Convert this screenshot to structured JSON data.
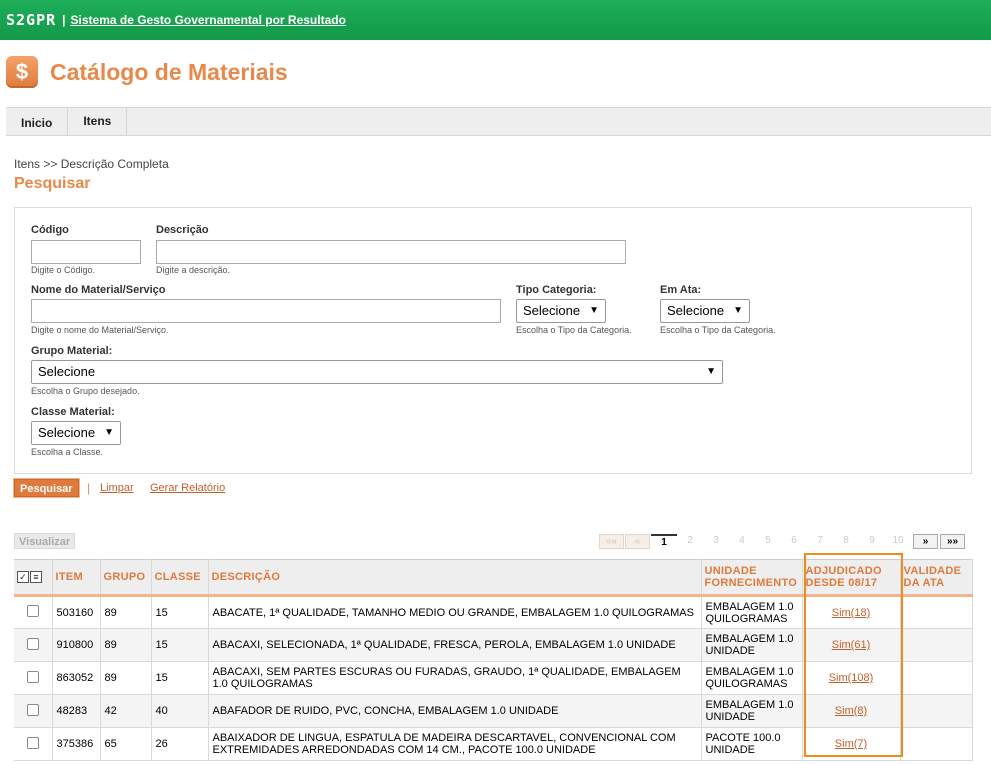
{
  "header": {
    "logo": "S2GPR",
    "separator": "|",
    "system_name": "Sistema de Gesto Governamental por Resultado"
  },
  "page": {
    "icon": "dollar-icon",
    "title": "Catálogo de Materiais"
  },
  "nav": {
    "tabs": [
      "Inicio",
      "Itens"
    ]
  },
  "breadcrumb": "Itens >> Descrição Completa",
  "section_title": "Pesquisar",
  "form": {
    "codigo": {
      "label": "Código",
      "hint": "Digite o Código.",
      "value": ""
    },
    "descricao": {
      "label": "Descrição",
      "hint": "Digite a descrição.",
      "value": ""
    },
    "nome": {
      "label": "Nome do Material/Serviço",
      "hint": "Digite o nome do Material/Serviço.",
      "value": ""
    },
    "tipo_categoria": {
      "label": "Tipo Categoria:",
      "hint": "Escolha o Tipo da Categoria.",
      "value": "Selecione"
    },
    "em_ata": {
      "label": "Em Ata:",
      "hint": "Escolha o Tipo da Categoria.",
      "value": "Selecione"
    },
    "grupo": {
      "label": "Grupo Material:",
      "hint": "Escolha o Grupo desejado.",
      "value": "Selecione"
    },
    "classe": {
      "label": "Classe Material:",
      "hint": "Escolha a Classe.",
      "value": "Selecione"
    }
  },
  "actions": {
    "search": "Pesquisar",
    "separator": "|",
    "clear": "Limpar",
    "report": "Gerar Relatório",
    "view": "Visualizar"
  },
  "pagination": {
    "first": "««",
    "prev": "«",
    "pages": [
      "1",
      "2",
      "3",
      "4",
      "5",
      "6",
      "7",
      "8",
      "9",
      "10"
    ],
    "current": "1",
    "next": "»",
    "last": "»»"
  },
  "table": {
    "columns": [
      "ITEM",
      "GRUPO",
      "CLASSE",
      "DESCRIÇÃO",
      "UNIDADE FORNECIMENTO",
      "ADJUDICADO DESDE 08/17",
      "VALIDADE DA ATA"
    ],
    "rows": [
      {
        "item": "503160",
        "grupo": "89",
        "classe": "15",
        "descricao": "ABACATE, 1ª QUALIDADE, TAMANHO MEDIO OU GRANDE, EMBALAGEM 1.0 QUILOGRAMAS",
        "unidade": "EMBALAGEM 1.0 QUILOGRAMAS",
        "adjudicado": "Sim(18)",
        "validade": ""
      },
      {
        "item": "910800",
        "grupo": "89",
        "classe": "15",
        "descricao": "ABACAXI, SELECIONADA, 1ª QUALIDADE, FRESCA, PEROLA, EMBALAGEM 1.0 UNIDADE",
        "unidade": "EMBALAGEM 1.0 UNIDADE",
        "adjudicado": "Sim(61)",
        "validade": ""
      },
      {
        "item": "863052",
        "grupo": "89",
        "classe": "15",
        "descricao": "ABACAXI, SEM PARTES ESCURAS OU FURADAS, GRAUDO, 1ª QUALIDADE, EMBALAGEM 1.0 QUILOGRAMAS",
        "unidade": "EMBALAGEM 1.0 QUILOGRAMAS",
        "adjudicado": "Sim(108)",
        "validade": ""
      },
      {
        "item": "48283",
        "grupo": "42",
        "classe": "40",
        "descricao": "ABAFADOR DE RUIDO, PVC, CONCHA, EMBALAGEM 1.0 UNIDADE",
        "unidade": "EMBALAGEM 1.0 UNIDADE",
        "adjudicado": "Sim(8)",
        "validade": ""
      },
      {
        "item": "375386",
        "grupo": "65",
        "classe": "26",
        "descricao": "ABAIXADOR DE LINGUA, ESPATULA DE MADEIRA DESCARTAVEL, CONVENCIONAL COM EXTREMIDADES ARREDONDADAS COM 14 CM., PACOTE 100.0 UNIDADE",
        "unidade": "PACOTE 100.0 UNIDADE",
        "adjudicado": "Sim(7)",
        "validade": ""
      }
    ]
  },
  "colors": {
    "header_green": "#1fae5a",
    "accent_orange": "#e07a3c",
    "highlight_orange": "#f08a1a"
  }
}
